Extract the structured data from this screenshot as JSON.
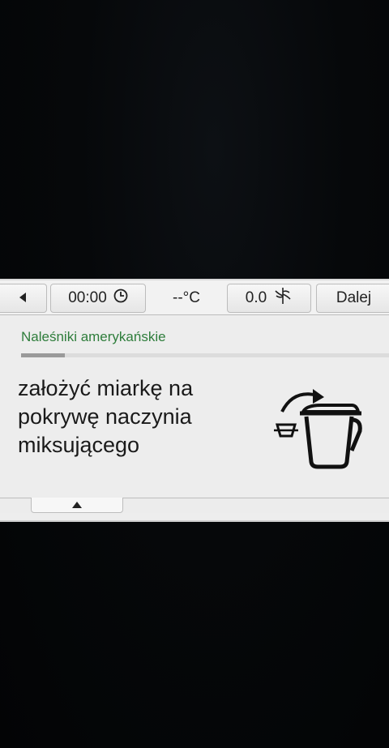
{
  "status_bar": {
    "time": "00:00",
    "temperature": "--°C",
    "speed": "0.0",
    "next_label": "Dalej"
  },
  "recipe": {
    "title": "Naleśniki amerykańskie",
    "progress": 0.12
  },
  "step": {
    "instruction": "założyć miarkę na\npokrywę naczynia\nmiksującego"
  },
  "icons": {
    "back": "back-arrow-icon",
    "clock": "clock-icon",
    "speed": "blade-icon",
    "illustration": "measuring-cup-onto-lid-icon",
    "scroll_up": "up-arrow-icon"
  },
  "colors": {
    "title": "#2e7d3b",
    "screen_background": "#ededed"
  }
}
